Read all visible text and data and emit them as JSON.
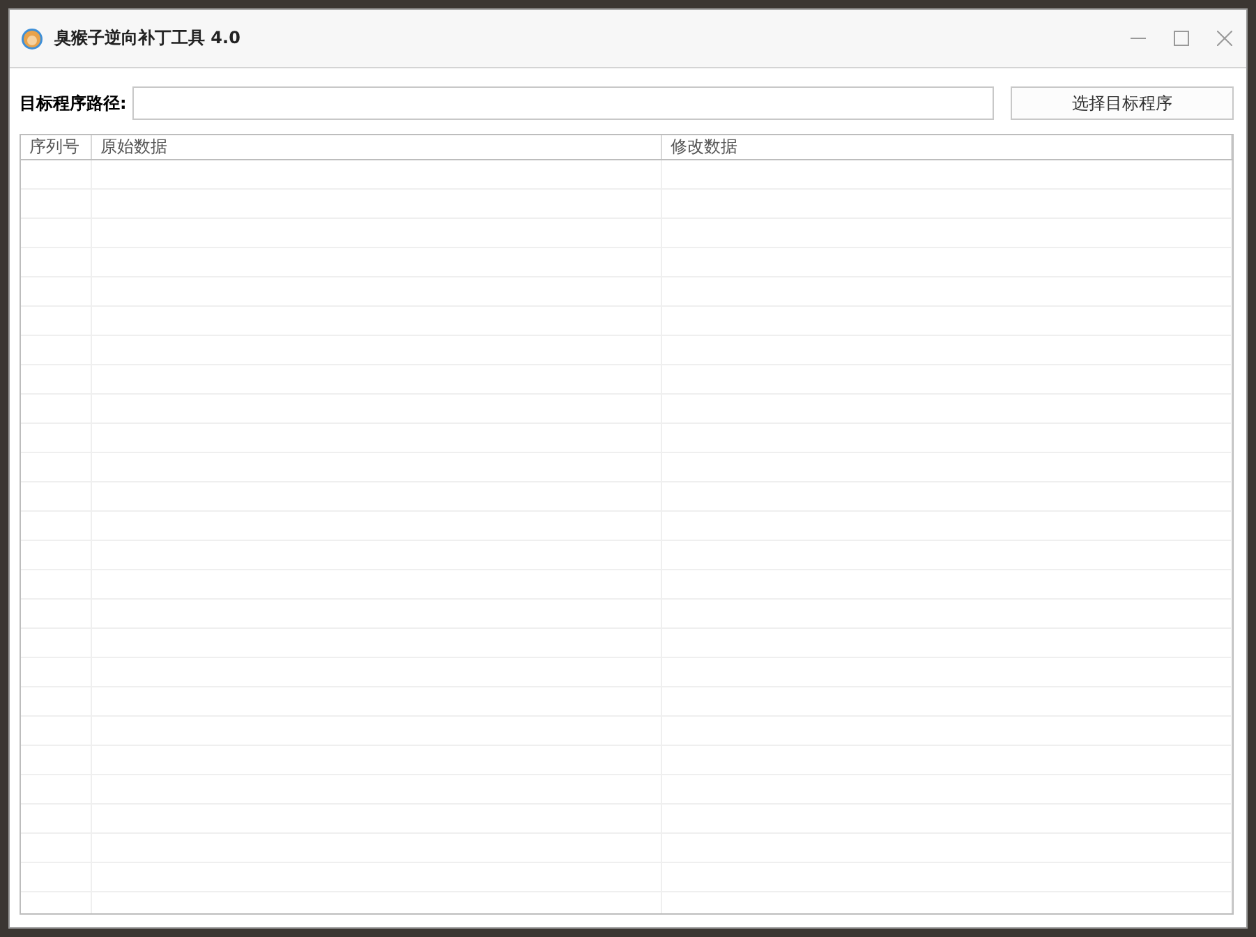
{
  "window": {
    "title": "臭猴子逆向补丁工具 4.0"
  },
  "path_label": "目标程序路径:",
  "select_button": "选择目标程序",
  "table": {
    "columns": [
      "序列号",
      "原始数据",
      "修改数据"
    ]
  }
}
